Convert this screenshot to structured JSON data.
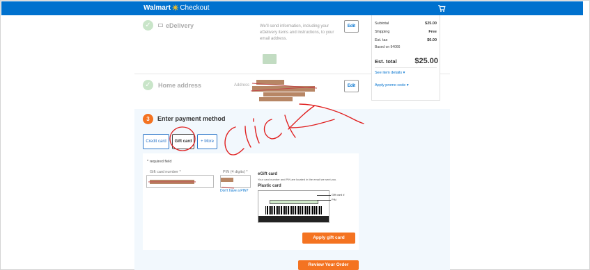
{
  "header": {
    "brand": "Walmart",
    "checkout_label": "Checkout",
    "spark_glyph": "✳",
    "cart_icon": "cart-icon",
    "color": "#0071ce"
  },
  "delivery": {
    "title": "eDelivery",
    "description": "We'll send information, including your eDelivery items and instructions, to your email address.",
    "edit_label": "Edit"
  },
  "home_address": {
    "title": "Home address",
    "address_label": "Address",
    "edit_label": "Edit"
  },
  "payment": {
    "step_number": "3",
    "title": "Enter payment method",
    "tabs": [
      {
        "label": "Credit card",
        "selected": false
      },
      {
        "label": "Gift card",
        "selected": true
      },
      {
        "label": "+ More",
        "selected": false
      }
    ],
    "required_note": "* required field",
    "gift_card_number_label": "Gift card number *",
    "pin_label": "PIN (4 digits) *",
    "pin_help": "Don't have a PIN?",
    "egift_title": "eGift card",
    "egift_note": "Your card number and PIN are located in the email we sent you.",
    "plastic_title": "Plastic card",
    "callout_gift_card": "Gift card #",
    "callout_pin": "PIN",
    "apply_button": "Apply gift card",
    "review_button": "Review Your Order",
    "accent": "#f47321"
  },
  "summary": {
    "subtotal_label": "Subtotal",
    "subtotal_value": "$25.00",
    "shipping_label": "Shipping",
    "shipping_value": "Free",
    "tax_label": "Est. tax",
    "tax_value": "$0.00",
    "based_on": "Based on 94066",
    "est_total_label": "Est. total",
    "est_total_value": "$25.00",
    "item_details_link": "See item details",
    "promo_link": "Apply promo code"
  },
  "annotation": {
    "scribble_word": "Click",
    "color": "#e02020"
  }
}
